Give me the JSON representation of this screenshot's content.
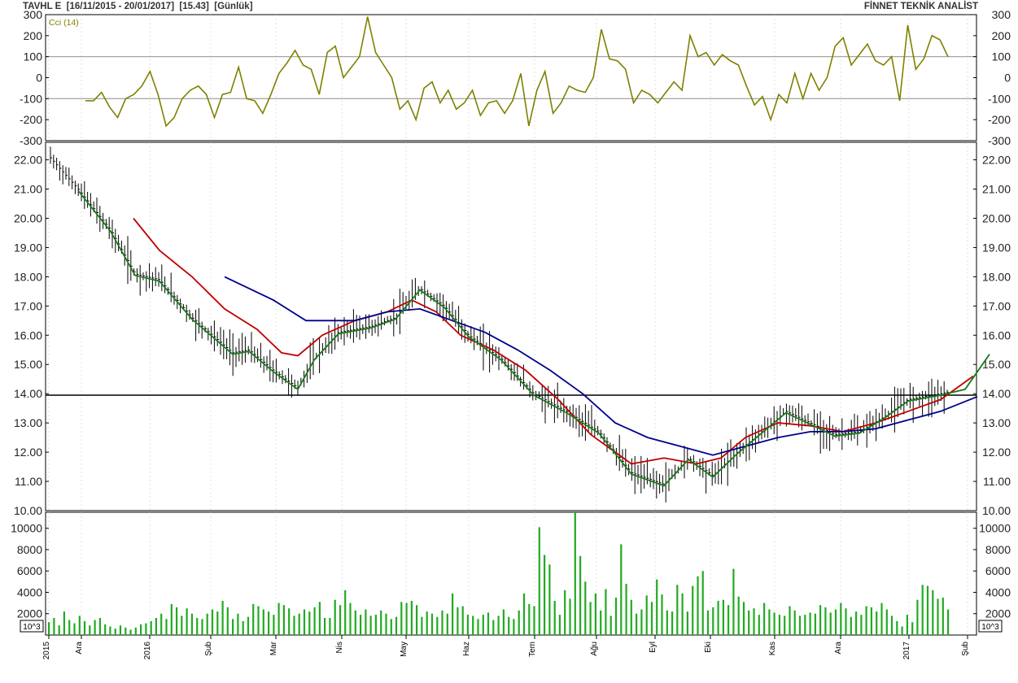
{
  "header": {
    "instrument": "TAVHL E",
    "date_range": "[16/11/2015 - 20/01/2017]",
    "last_price": "[15.43]",
    "period": "[Günlük]",
    "brand": "FİNNET TEKNİK ANALİST"
  },
  "colors": {
    "cci": "#808000",
    "ma_short": "#1a7a1a",
    "ma_mid": "#c00000",
    "ma_long": "#00008b",
    "price_bars": "#000000",
    "volume": "#22aa22",
    "hline": "#000000"
  },
  "chart_data": [
    {
      "type": "line",
      "name": "cci-panel",
      "label": "Cci (14)",
      "ylim": [
        -300,
        300
      ],
      "y_ticks": [
        "300",
        "200",
        "100",
        "0",
        "-100",
        "-200",
        "-300"
      ],
      "reference_lines": [
        100,
        -100
      ],
      "x": [
        5,
        7,
        9,
        12,
        15,
        18,
        21,
        24,
        27,
        30,
        34,
        38,
        40,
        43,
        46,
        50,
        54,
        58,
        62,
        66,
        70,
        74,
        78,
        82,
        86,
        90,
        94,
        98,
        102,
        106,
        110,
        114,
        118,
        122,
        126,
        130,
        134,
        138,
        142,
        146,
        150,
        154,
        158,
        162,
        166,
        170,
        174,
        178,
        182,
        186,
        190,
        194,
        198,
        202,
        206,
        210,
        214,
        218,
        222,
        226,
        230,
        234,
        238,
        242,
        246,
        250,
        254,
        258,
        262,
        266,
        270,
        274,
        278,
        282,
        286,
        290,
        294,
        300
      ],
      "values": [
        -110,
        -110,
        -70,
        -140,
        -190,
        -100,
        -80,
        -40,
        30,
        -80,
        -230,
        -190,
        -100,
        -60,
        -40,
        -80,
        -190,
        -80,
        -70,
        50,
        -100,
        -110,
        -170,
        -80,
        20,
        70,
        130,
        60,
        40,
        -80,
        120,
        150,
        0,
        50,
        100,
        290,
        120,
        60,
        0,
        -150,
        -110,
        -200,
        -50,
        -20,
        -120,
        -60,
        -150,
        -120,
        -60,
        -180,
        -120,
        -110,
        -170,
        -110,
        20,
        -230,
        -60,
        30,
        -170,
        -120,
        -40,
        -60,
        -70,
        0,
        230,
        90,
        80,
        40,
        -120,
        -60,
        -80,
        -120,
        -70,
        -20,
        -60,
        200,
        100,
        120,
        60,
        110,
        80,
        60,
        -40,
        -130,
        -90,
        -200,
        -80,
        -120,
        20,
        -100,
        20,
        -60,
        0,
        150,
        190,
        60,
        110,
        160,
        80,
        60,
        100,
        -110,
        250,
        40,
        90,
        200,
        180,
        100
      ]
    },
    {
      "type": "line",
      "name": "price-panel",
      "ylim": [
        10,
        22.6
      ],
      "y_ticks": [
        "22.00",
        "21.00",
        "20.00",
        "19.00",
        "18.00",
        "17.00",
        "16.00",
        "15.00",
        "14.00",
        "13.00",
        "12.00",
        "11.00",
        "10.00"
      ],
      "horizontal_line": 13.95,
      "last_close": 15.43,
      "series": [
        {
          "key": "ma_short",
          "x": [
            20,
            40,
            60,
            80,
            100,
            120,
            140,
            160,
            180,
            200,
            220,
            240,
            260,
            280,
            300
          ],
          "values": [
            21.8,
            21.2,
            20.2,
            19.6,
            19.0,
            18.3,
            17.8,
            17.5,
            17.2,
            17.0,
            16.6,
            16.2,
            16.0,
            15.8,
            15.3
          ]
        },
        {
          "key": "price",
          "x": [
            5,
            40,
            80,
            110,
            140,
            180,
            230,
            250,
            280,
            310,
            330,
            360,
            400,
            430,
            460,
            490,
            520,
            560,
            600,
            640,
            680,
            720,
            760,
            790,
            820,
            850,
            880,
            910,
            940,
            970,
            1000,
            1030,
            1060,
            1100,
            1130,
            1160
          ],
          "values": [
            22.1,
            21.0,
            19.6,
            18.1,
            17.9,
            16.6,
            15.4,
            15.5,
            14.8,
            14.2,
            15.2,
            16.1,
            16.3,
            16.6,
            17.6,
            17.0,
            16.0,
            15.2,
            14.0,
            13.4,
            12.7,
            11.3,
            10.9,
            11.8,
            11.2,
            12.0,
            12.7,
            13.4,
            13.0,
            12.6,
            12.7,
            13.2,
            13.8,
            14.0,
            14.2,
            15.4
          ]
        },
        {
          "key": "ma_mid",
          "x": [
            128,
            160,
            200,
            240,
            280,
            310,
            330,
            360,
            400,
            440,
            470,
            500,
            530,
            570,
            610,
            650,
            690,
            740,
            780,
            820,
            850,
            880,
            920,
            960,
            1000,
            1040,
            1080,
            1120,
            1160
          ],
          "values": [
            20.0,
            18.9,
            18.0,
            16.9,
            16.2,
            15.4,
            15.3,
            16.0,
            16.5,
            16.8,
            17.2,
            16.8,
            16.0,
            15.5,
            14.8,
            13.8,
            12.6,
            11.6,
            11.8,
            11.6,
            11.8,
            12.5,
            13.0,
            12.9,
            12.7,
            13.0,
            13.4,
            13.8,
            14.6
          ]
        },
        {
          "key": "ma_long",
          "x": [
            240,
            300,
            340,
            400,
            440,
            480,
            520,
            560,
            600,
            640,
            680,
            720,
            760,
            800,
            840,
            880,
            920,
            960,
            1000,
            1040,
            1080,
            1120,
            1165
          ],
          "values": [
            18.0,
            17.2,
            16.5,
            16.5,
            16.8,
            16.9,
            16.5,
            16.1,
            15.5,
            14.8,
            14.0,
            13.0,
            12.5,
            12.2,
            11.9,
            12.2,
            12.5,
            12.7,
            12.7,
            12.8,
            13.1,
            13.4,
            13.9
          ]
        }
      ]
    },
    {
      "type": "bar",
      "name": "volume-panel",
      "ylim": [
        0,
        11500
      ],
      "y_ticks": [
        "10000",
        "8000",
        "6000",
        "4000",
        "2000"
      ],
      "unit_label": "10^3",
      "seed_note": "",
      "x_start": 60,
      "x_step": 3.8,
      "values": [
        1200,
        1600,
        900,
        2200,
        1400,
        1100,
        1800,
        1300,
        900,
        1400,
        1600,
        1000,
        800,
        600,
        900,
        700,
        500,
        700,
        1000,
        1100,
        1300,
        1600,
        2000,
        1500,
        2900,
        2600,
        1800,
        2500,
        2000,
        1600,
        1500,
        2000,
        2400,
        2200,
        3200,
        2600,
        1500,
        2000,
        1300,
        1700,
        2900,
        2700,
        2400,
        2200,
        1900,
        3000,
        2800,
        2500,
        1800,
        2000,
        2400,
        2200,
        2600,
        3100,
        1600,
        1600,
        3300,
        2800,
        4200,
        3000,
        2300,
        1900,
        2400,
        1800,
        1900,
        2300,
        2000,
        1500,
        1700,
        3100,
        3000,
        3200,
        2800,
        1700,
        2200,
        2000,
        1700,
        2300,
        2000,
        3900,
        2600,
        2700,
        1900,
        1800,
        1500,
        1900,
        2100,
        1400,
        1800,
        2400,
        1700,
        1500,
        2300,
        3900,
        2900,
        2700,
        10100,
        7500,
        6600,
        3200,
        1900,
        4200,
        3400,
        11500,
        7400,
        5000,
        3100,
        3900,
        2300,
        4300,
        1800,
        3500,
        8500,
        4800,
        3300,
        2000,
        2400,
        3700,
        3100,
        5200,
        3800,
        2300,
        2200,
        4700,
        3900,
        2200,
        4600,
        5500,
        6000,
        2300,
        2600,
        3200,
        3300,
        2800,
        6200,
        3600,
        3100,
        2300,
        2500,
        1900,
        3000,
        2400,
        2100,
        1900,
        1800,
        2700,
        2300,
        1800,
        1900,
        2100,
        2000,
        2800,
        2600,
        2100,
        2400,
        3000,
        2500,
        1700,
        2200,
        1900,
        2700,
        2600,
        2200,
        3000,
        2400,
        1800,
        1300,
        800,
        1900,
        1200,
        3300,
        4700,
        4600,
        4200,
        3400,
        3500,
        2400
      ]
    }
  ],
  "x_axis": {
    "labels": [
      {
        "text": "2015",
        "x": 60
      },
      {
        "text": "Ara",
        "x": 100
      },
      {
        "text": "2016",
        "x": 184
      },
      {
        "text": "Şub",
        "x": 259
      },
      {
        "text": "Mar",
        "x": 339
      },
      {
        "text": "Nis",
        "x": 420
      },
      {
        "text": "May",
        "x": 499
      },
      {
        "text": "Haz",
        "x": 576
      },
      {
        "text": "Tem",
        "x": 657
      },
      {
        "text": "Ağu",
        "x": 733
      },
      {
        "text": "Eyl",
        "x": 805
      },
      {
        "text": "Eki",
        "x": 873
      },
      {
        "text": "Kas",
        "x": 952
      },
      {
        "text": "Ara",
        "x": 1033
      },
      {
        "text": "2017",
        "x": 1117
      },
      {
        "text": "Şub",
        "x": 1189
      }
    ]
  }
}
